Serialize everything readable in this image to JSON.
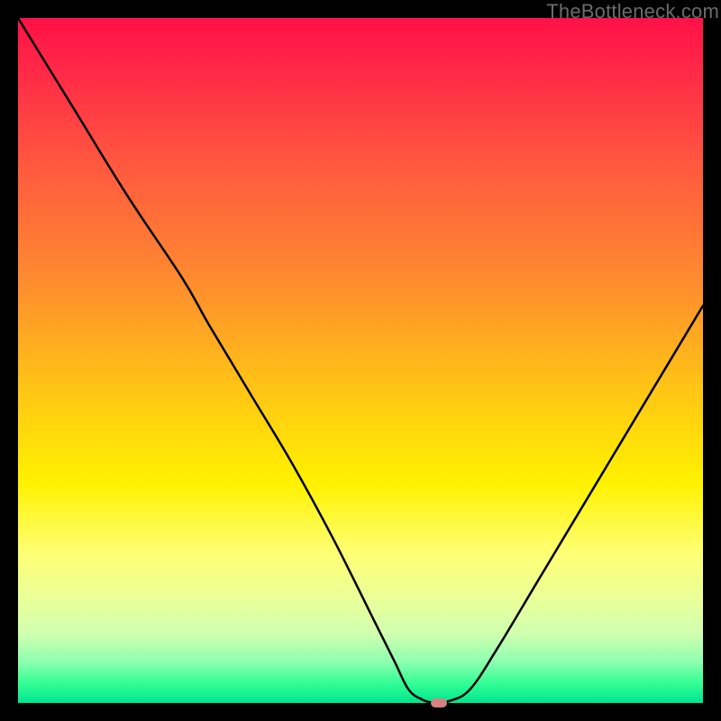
{
  "watermark": "TheBottleneck.com",
  "colors": {
    "page_bg": "#000000",
    "curve_stroke": "#000000",
    "marker_fill": "#d98080"
  },
  "chart_data": {
    "type": "line",
    "title": "",
    "xlabel": "",
    "ylabel": "",
    "xlim": [
      0,
      100
    ],
    "ylim": [
      0,
      100
    ],
    "grid": false,
    "legend": false,
    "series": [
      {
        "name": "bottleneck-curve",
        "x": [
          0,
          8,
          16,
          24,
          28,
          34,
          40,
          46,
          52,
          55,
          57,
          59,
          61,
          63,
          66,
          70,
          76,
          82,
          88,
          94,
          100
        ],
        "values": [
          100,
          87,
          74,
          62,
          55,
          45,
          35,
          24,
          12,
          6,
          2,
          0.5,
          0,
          0.3,
          2,
          8,
          18,
          28,
          38,
          48,
          58
        ]
      }
    ],
    "marker": {
      "x": 61.5,
      "y": 0
    },
    "gradient_stops": [
      {
        "pos": 0,
        "color": "#ff1147"
      },
      {
        "pos": 8,
        "color": "#ff2a47"
      },
      {
        "pos": 22,
        "color": "#ff5a3f"
      },
      {
        "pos": 38,
        "color": "#ff8a2f"
      },
      {
        "pos": 55,
        "color": "#ffc814"
      },
      {
        "pos": 68,
        "color": "#fff200"
      },
      {
        "pos": 78,
        "color": "#ffff73"
      },
      {
        "pos": 85,
        "color": "#eaff9a"
      },
      {
        "pos": 90,
        "color": "#cfffb0"
      },
      {
        "pos": 94,
        "color": "#8dffb0"
      },
      {
        "pos": 97,
        "color": "#36ff95"
      },
      {
        "pos": 100,
        "color": "#00e58f"
      }
    ]
  }
}
